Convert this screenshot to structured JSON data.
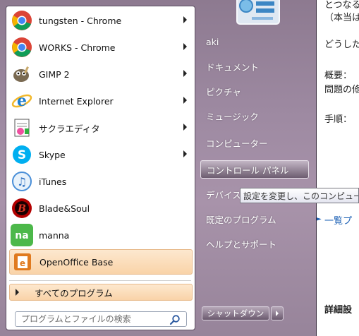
{
  "background_document": {
    "lines": [
      "とつなる",
      "（本当は",
      "どうしたら",
      "概要：",
      "問題の修",
      "手順：",
      "一覧プ",
      "詳細設"
    ]
  },
  "start_menu": {
    "pinned_programs": [
      {
        "label": "tungsten - Chrome",
        "icon": "chrome-icon",
        "has_submenu": true
      },
      {
        "label": "WORKS - Chrome",
        "icon": "chrome-icon",
        "has_submenu": true
      },
      {
        "label": "GIMP 2",
        "icon": "gimp-icon",
        "has_submenu": true
      },
      {
        "label": "Internet Explorer",
        "icon": "internet-explorer-icon",
        "has_submenu": true
      },
      {
        "label": "サクラエディタ",
        "icon": "sakura-editor-icon",
        "has_submenu": true
      },
      {
        "label": "Skype",
        "icon": "skype-icon",
        "has_submenu": true
      },
      {
        "label": "iTunes",
        "icon": "itunes-icon",
        "has_submenu": false
      },
      {
        "label": "Blade&Soul",
        "icon": "blade-and-soul-icon",
        "has_submenu": false
      },
      {
        "label": "manna",
        "icon": "manna-icon",
        "has_submenu": false
      },
      {
        "label": "OpenOffice Base",
        "icon": "openoffice-base-icon",
        "has_submenu": false,
        "highlighted": true
      }
    ],
    "all_programs_label": "すべてのプログラム",
    "search_placeholder": "プログラムとファイルの検索",
    "right_items": [
      {
        "label": "aki"
      },
      {
        "label": "ドキュメント"
      },
      {
        "label": "ピクチャ"
      },
      {
        "label": "ミュージック"
      },
      {
        "label": "コンピューター"
      },
      {
        "label": "コントロール パネル",
        "selected": true
      },
      {
        "label": "デバイス"
      },
      {
        "label": "既定のプログラム"
      },
      {
        "label": "ヘルプとサポート"
      }
    ],
    "shutdown_label": "シャットダウン",
    "tooltip_text": "設定を変更し、このコンピューターの機能をカスタマイズします。",
    "colors": {
      "right_pane": "#9e8aa2",
      "highlight": "#f9d3a8",
      "link": "#1a5fb4"
    }
  }
}
